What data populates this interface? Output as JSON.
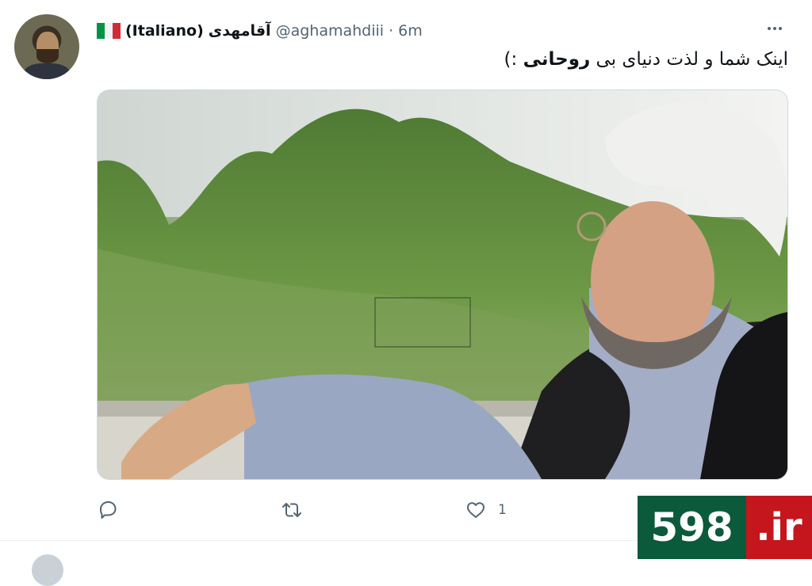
{
  "tweet": {
    "author": {
      "flag_emoji": "🇮🇹",
      "display_name_latin": "(Italiano)",
      "display_name_fa": "آقامهدی",
      "handle": "@aghamahdiii",
      "separator": "·",
      "time": "6m"
    },
    "text": {
      "prefix": "اینک شما و لذت دنیای بی ",
      "bold": "روحانی",
      "suffix": " :)"
    },
    "actions": {
      "reply_icon": "reply-icon",
      "retweet_icon": "retweet-icon",
      "like_icon": "heart-icon",
      "like_count": "1"
    }
  },
  "watermark": {
    "number": "598",
    "tld": ".ir",
    "colors": {
      "number_bg": "#0b5a3b",
      "tld_bg": "#c4161c"
    }
  },
  "colors": {
    "text": "#0f1419",
    "secondary": "#536471",
    "border": "#cfd9de"
  }
}
